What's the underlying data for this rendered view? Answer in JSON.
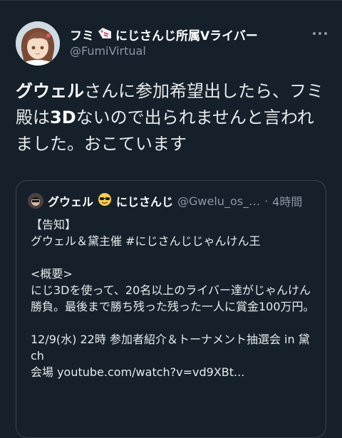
{
  "tweet": {
    "display_name_part1": "フミ",
    "display_name_part2": "にじさんじ所属Vライバー",
    "handle": "@FumiVirtual",
    "text_seg1": "グウェル",
    "text_seg2": "さんに参加希望出したら、フミ殿は",
    "text_seg3": "3D",
    "text_seg4": "ないので出られませんと言われました。おこています",
    "more_icon": "more-dots-icon"
  },
  "quote": {
    "name_part1": "グウェル",
    "name_part2": "にじさんじ",
    "handle": "@Gwelu_os_…",
    "separator": "·",
    "time": "4時間",
    "body": "【告知】\nグウェル＆黛主催 #にじさんじじゃんけん王\n\n<概要>\nにじ3Dを使って、20名以上のライバー達がじゃんけん勝負。最後まで勝ち残った残った一人に賞金100万円。\n\n12/9(水) 22時 参加者紹介＆トーナメント抽選会 in 黛ch\n会場 youtube.com/watch?v=vd9XBt..."
  },
  "colors": {
    "background": "#15202b",
    "text_primary": "#e7e9ea",
    "text_secondary": "#8b98a5",
    "border": "#38444d"
  }
}
